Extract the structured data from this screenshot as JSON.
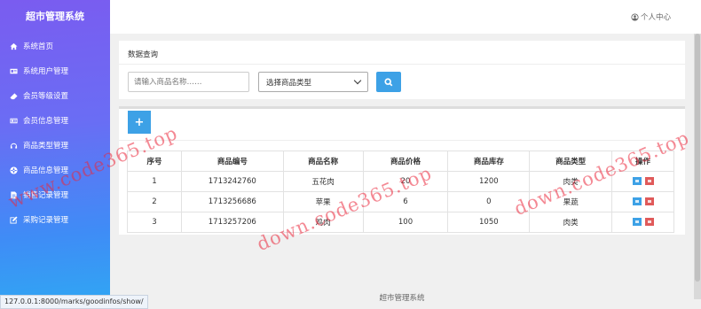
{
  "app": {
    "title": "超市管理系统",
    "footer": "超市管理系统"
  },
  "sidebar": {
    "items": [
      {
        "label": "系统首页",
        "icon": "home-icon"
      },
      {
        "label": "系统用户管理",
        "icon": "id-card-icon"
      },
      {
        "label": "会员等级设置",
        "icon": "eraser-icon"
      },
      {
        "label": "会员信息管理",
        "icon": "address-card-icon"
      },
      {
        "label": "商品类型管理",
        "icon": "headphones-icon"
      },
      {
        "label": "商品信息管理",
        "icon": "globe-icon"
      },
      {
        "label": "销售记录管理",
        "icon": "document-icon"
      },
      {
        "label": "采购记录管理",
        "icon": "edit-icon"
      }
    ]
  },
  "header": {
    "user_label": "个人中心",
    "user_icon": "user-circle-icon"
  },
  "query": {
    "title": "数据查询",
    "search_placeholder": "请输入商品名称……",
    "type_select": "选择商品类型",
    "search_icon": "search-icon"
  },
  "list": {
    "add_label": "+",
    "columns": [
      "序号",
      "商品编号",
      "商品名称",
      "商品价格",
      "商品库存",
      "商品类型",
      "操作"
    ],
    "rows": [
      {
        "no": "1",
        "code": "1713242760",
        "name": "五花肉",
        "price": "20",
        "stock": "1200",
        "type": "肉类"
      },
      {
        "no": "2",
        "code": "1713256686",
        "name": "苹果",
        "price": "6",
        "stock": "0",
        "type": "果蔬"
      },
      {
        "no": "3",
        "code": "1713257206",
        "name": "鸡肉",
        "price": "100",
        "stock": "1050",
        "type": "肉类"
      }
    ]
  },
  "status_url": "127.0.0.1:8000/marks/goodinfos/show/",
  "watermarks": [
    "www.code365.top",
    "down.code365.top",
    "down.code365.top"
  ],
  "colors": {
    "accent": "#3da1e6",
    "danger": "#e05a5a",
    "sidebar_top": "#7a5cf0",
    "sidebar_bottom": "#2fa8f3"
  }
}
